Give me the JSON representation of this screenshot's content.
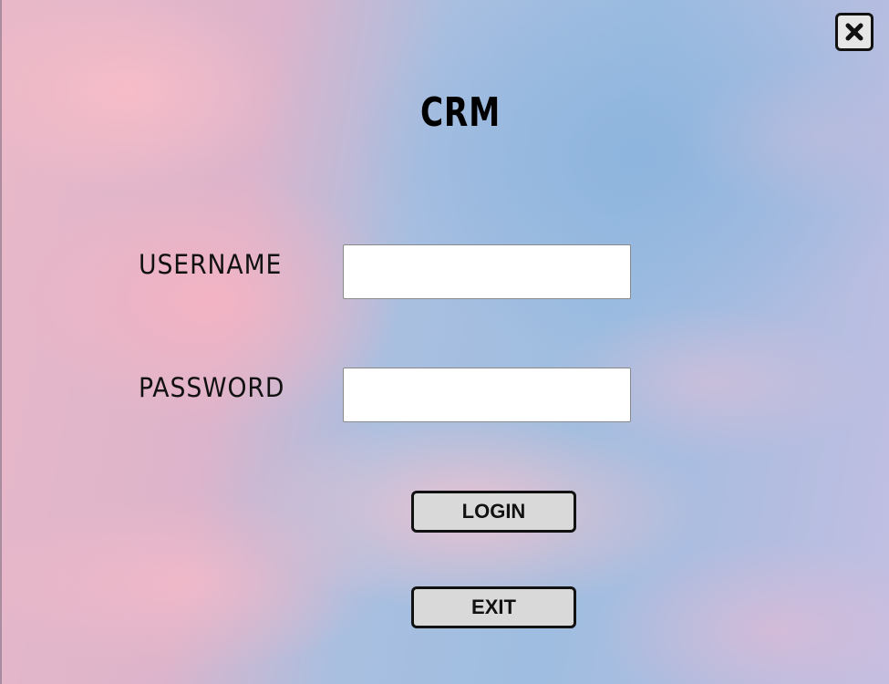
{
  "app": {
    "title": "CRM"
  },
  "close_button": {
    "icon": "close-icon"
  },
  "form": {
    "username_label": "USERNAME",
    "username_value": "",
    "password_label": "PASSWORD",
    "password_value": ""
  },
  "actions": {
    "login_label": "LOGIN",
    "exit_label": "EXIT"
  },
  "colors": {
    "button_bg": "#d9d9d9",
    "button_border": "#111111",
    "field_bg": "#ffffff",
    "sky_pink": "#e9b8c8",
    "sky_blue": "#9ebde0"
  }
}
